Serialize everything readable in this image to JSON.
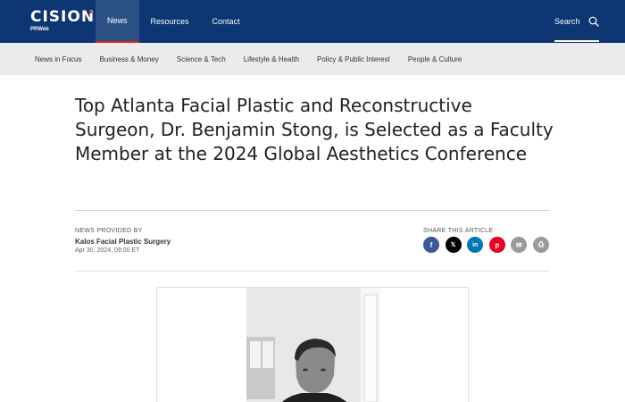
{
  "header": {
    "logo_main": "CISION",
    "logo_sub": "PRWeb",
    "nav": [
      {
        "label": "News",
        "active": true
      },
      {
        "label": "Resources",
        "active": false
      },
      {
        "label": "Contact",
        "active": false
      }
    ],
    "search_label": "Search",
    "search_icon": "search-icon"
  },
  "categories": [
    "News in Focus",
    "Business & Money",
    "Science & Tech",
    "Lifestyle & Health",
    "Policy & Public Interest",
    "People & Culture"
  ],
  "article": {
    "headline": "Top Atlanta Facial Plastic and Reconstructive Surgeon, Dr. Benjamin Stong, is Selected as a Faculty Member at the 2024 Global Aesthetics Conference",
    "provided_label": "NEWS PROVIDED BY",
    "provider": "Kalos Facial Plastic Surgery",
    "date": "Apr 30, 2024, 09:00 ET",
    "share_label": "SHARE THIS ARTICLE",
    "share_buttons": [
      {
        "icon": "facebook-icon",
        "glyph": "f",
        "color": "#3b5998"
      },
      {
        "icon": "x-icon",
        "glyph": "𝕏",
        "color": "#000000"
      },
      {
        "icon": "linkedin-icon",
        "glyph": "in",
        "color": "#0077b5"
      },
      {
        "icon": "pinterest-icon",
        "glyph": "p",
        "color": "#e60023"
      },
      {
        "icon": "email-icon",
        "glyph": "✉",
        "color": "#9a9a9a"
      },
      {
        "icon": "print-icon",
        "glyph": "⎙",
        "color": "#9a9a9a"
      }
    ]
  },
  "colors": {
    "header_bg": "#0d3672",
    "nav_active_bg": "#2b5185",
    "accent_red": "#e2231a",
    "category_bar_bg": "#ebebeb"
  }
}
